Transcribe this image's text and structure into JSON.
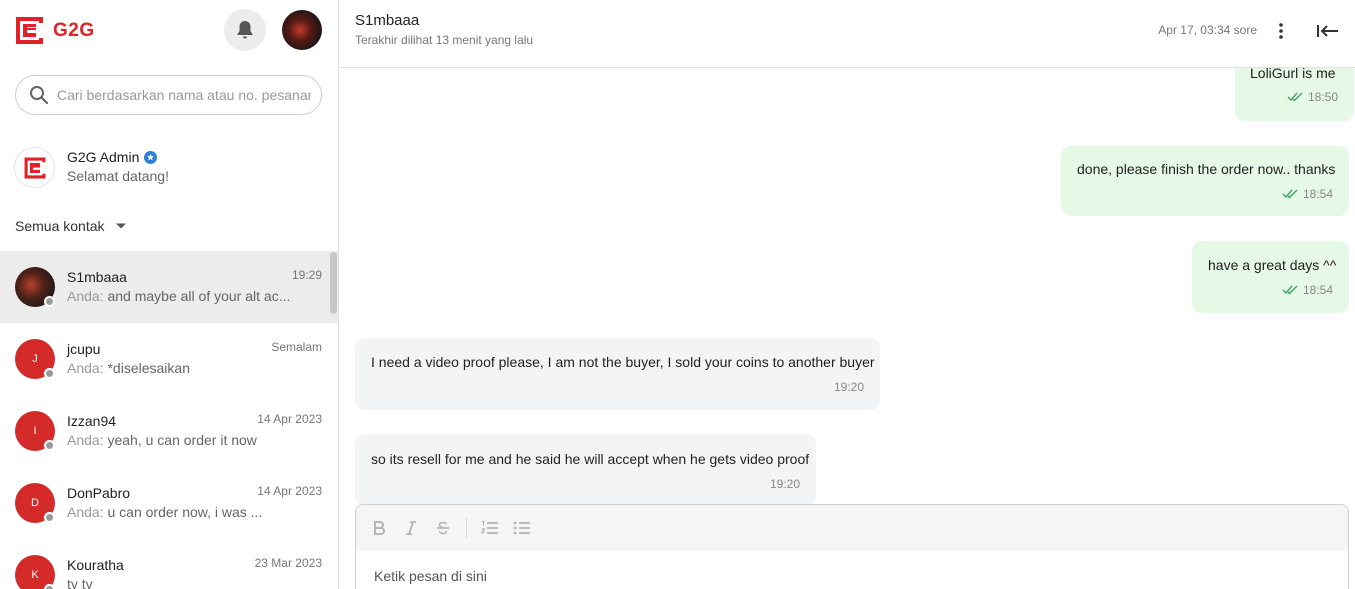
{
  "brand": {
    "name": "G2G",
    "color": "#e02127"
  },
  "search": {
    "placeholder": "Cari berdasarkan nama atau no. pesanan"
  },
  "admin": {
    "name": "G2G Admin",
    "subtitle": "Selamat datang!"
  },
  "filter": {
    "label": "Semua kontak"
  },
  "contacts": [
    {
      "name": "S1mbaaa",
      "time": "19:29",
      "you": "Anda:",
      "preview": "and maybe all of your alt ac...",
      "initial": ""
    },
    {
      "name": "jcupu",
      "time": "Semalam",
      "you": "Anda:",
      "preview": "*diselesaikan",
      "initial": "J"
    },
    {
      "name": "Izzan94",
      "time": "14 Apr 2023",
      "you": "Anda:",
      "preview": "yeah, u can order it now",
      "initial": "I"
    },
    {
      "name": "DonPabro",
      "time": "14 Apr 2023",
      "you": "Anda:",
      "preview": "u can order now, i was ...",
      "initial": "D"
    },
    {
      "name": "Kouratha",
      "time": "23 Mar 2023",
      "you": "",
      "preview": "ty ty",
      "initial": "K"
    }
  ],
  "chat": {
    "name": "S1mbaaa",
    "last_seen": "Terakhir dilihat 13 menit yang lalu",
    "date": "Apr 17, 03:34 sore"
  },
  "messages": [
    {
      "text": "LoliGurl is me",
      "time": "18:50",
      "dir": "out"
    },
    {
      "text": "done, please finish the order now.. thanks",
      "time": "18:54",
      "dir": "out"
    },
    {
      "text": "have a great days ^^",
      "time": "18:54",
      "dir": "out"
    },
    {
      "text": "I need a video proof please, I am not the buyer, I sold your coins to another buyer",
      "time": "19:20",
      "dir": "in"
    },
    {
      "text": "so its resell for me and he said he will accept when he gets video proof",
      "time": "19:20",
      "dir": "in"
    }
  ],
  "composer": {
    "placeholder": "Ketik pesan di sini",
    "tools": [
      "bold-icon",
      "italic-icon",
      "strikethrough-icon",
      "numbered-list-icon",
      "bullet-list-icon"
    ]
  },
  "icons": {
    "read_tick_color": "#3ea46a",
    "status_offline_color": "#9b9b9b"
  }
}
